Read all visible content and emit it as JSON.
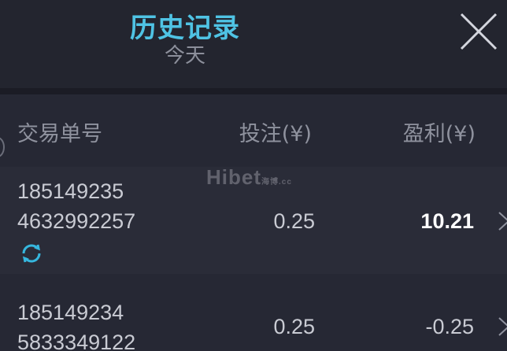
{
  "header": {
    "title": "历史记录",
    "subtitle": "今天"
  },
  "columns": {
    "order_id": "交易单号",
    "bet": "投注(¥)",
    "profit": "盈利(¥)"
  },
  "watermark": {
    "main": "Hibet",
    "suffix": "海博.cc"
  },
  "rows": [
    {
      "id_line1": "185149235",
      "id_line2": "4632992257",
      "bet": "0.25",
      "profit": "10.21",
      "status_icon": "refresh-icon"
    },
    {
      "id_line1": "185149234",
      "id_line2": "5833349122",
      "bet": "0.25",
      "profit": "-0.25"
    }
  ],
  "colors": {
    "accent": "#4fc3e4",
    "background": "#232531"
  }
}
